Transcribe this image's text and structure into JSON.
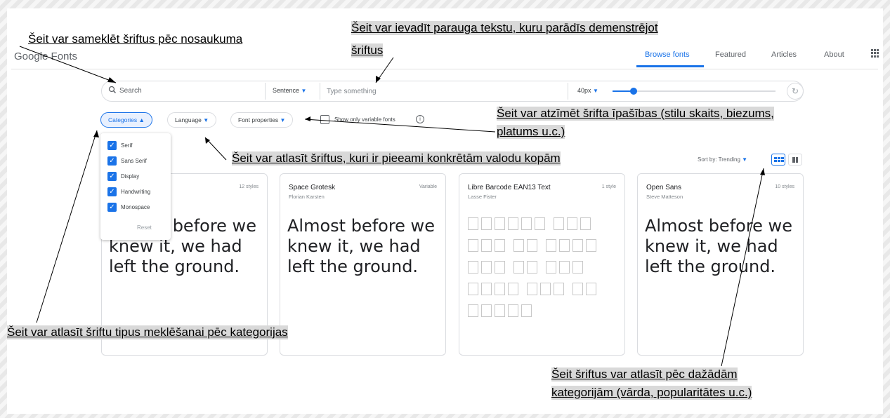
{
  "app": {
    "logo": "Google Fonts",
    "nav": [
      {
        "label": "Browse fonts",
        "active": true
      },
      {
        "label": "Featured",
        "active": false
      },
      {
        "label": "Articles",
        "active": false
      },
      {
        "label": "About",
        "active": false
      }
    ]
  },
  "toolbar": {
    "search_placeholder": "Search",
    "preview_mode": "Sentence",
    "preview_placeholder": "Type something",
    "size": "40px",
    "size_slider_fraction": 0.13
  },
  "filters": {
    "categories": "Categories",
    "language": "Language",
    "font_properties": "Font properties",
    "variable_only": "Show only variable fonts"
  },
  "category_menu": {
    "items": [
      {
        "label": "Serif",
        "checked": true
      },
      {
        "label": "Sans Serif",
        "checked": true
      },
      {
        "label": "Display",
        "checked": true
      },
      {
        "label": "Handwriting",
        "checked": true
      },
      {
        "label": "Monospace",
        "checked": true
      }
    ],
    "reset": "Reset"
  },
  "sort": {
    "label": "Sort by: Trending"
  },
  "cards": [
    {
      "name": "",
      "author": "",
      "styles": "12 styles",
      "sample": "Almost before we knew it, we had left the ground."
    },
    {
      "name": "Space Grotesk",
      "author": "Florian Karsten",
      "styles": "Variable",
      "sample": "Almost before we knew it, we had left the ground."
    },
    {
      "name": "Libre Barcode EAN13 Text",
      "author": "Lasse Fister",
      "styles": "1 style",
      "sample": ""
    },
    {
      "name": "Open Sans",
      "author": "Steve Matteson",
      "styles": "10 styles",
      "sample": "Almost before we knew it, we had left the ground."
    }
  ],
  "annotations": {
    "search": "Šeit var sameklēt šriftus pēc nosaukuma",
    "preview_line1": "Šeit var ievadīt parauga tekstu, kuru parādīs demenstrējot",
    "preview_line2": "šriftus",
    "properties_line1": "Šeit var atzīmēt šrifta īpašības (stilu skaits, biezums,",
    "properties_line2": "platums u.c.)",
    "language": "Šeit var atlasīt šriftus, kuri ir pieeami konkrētām valodu kopām",
    "categories": "Šeit var atlasīt šriftu tipus meklēšanai pēc kategorijas",
    "sort_line1": "Šeit šriftus var atlasīt pēc dažādām",
    "sort_line2": "kategorijām (vārda, popularitātes u.c.)"
  },
  "colors": {
    "accent": "#1a73e8",
    "annotation_bg": "#d9d9d9"
  }
}
